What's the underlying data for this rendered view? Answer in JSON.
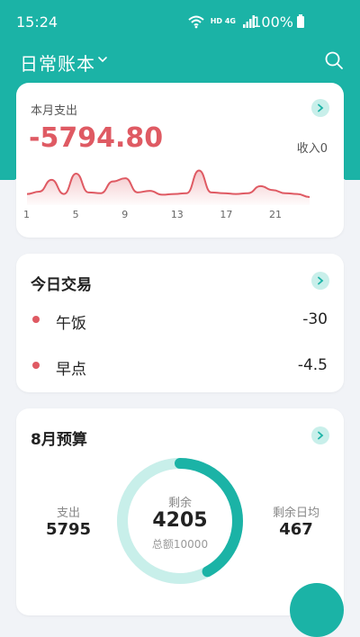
{
  "status": {
    "time": "15:24",
    "battery": "100%",
    "network": "HD 4G"
  },
  "header": {
    "title": "日常账本"
  },
  "monthly": {
    "label": "本月支出",
    "amount": "-5794.80",
    "income": "收入0",
    "chart_data": {
      "type": "area",
      "x_ticks": [
        "1",
        "5",
        "9",
        "13",
        "17",
        "21"
      ],
      "x": [
        1,
        2,
        3,
        4,
        5,
        6,
        7,
        8,
        9,
        10,
        11,
        12,
        13,
        14,
        15,
        16,
        17,
        18,
        19,
        20,
        21,
        22,
        23,
        24
      ],
      "values": [
        12,
        15,
        30,
        12,
        38,
        14,
        13,
        28,
        32,
        14,
        16,
        11,
        12,
        13,
        42,
        14,
        13,
        12,
        13,
        22,
        17,
        13,
        12,
        8
      ],
      "color": "#df5a63"
    }
  },
  "today": {
    "title": "今日交易",
    "items": [
      {
        "name": "午饭",
        "amount": "-30"
      },
      {
        "name": "早点",
        "amount": "-4.5"
      }
    ]
  },
  "budget": {
    "title": "8月预算",
    "spent_label": "支出",
    "spent_value": "5795",
    "remaining_label": "剩余",
    "remaining_value": "4205",
    "total_label": "总额10000",
    "daily_label": "剩余日均",
    "daily_value": "467",
    "remaining_fraction": 0.4205,
    "colors": {
      "remaining": "#1bb3a6",
      "spent": "#c8efea"
    }
  },
  "colors": {
    "accent": "#1bb3a6",
    "expense": "#df5a63"
  }
}
